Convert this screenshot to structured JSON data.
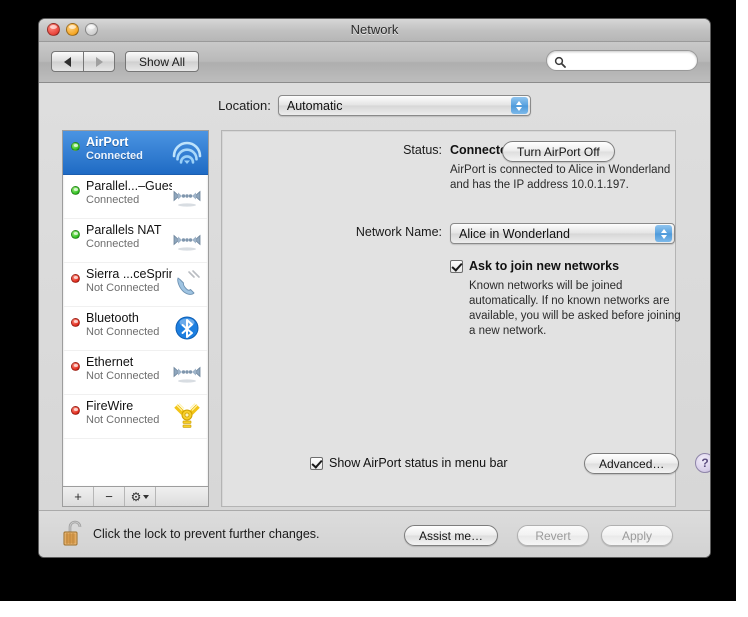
{
  "window": {
    "title": "Network",
    "traffic_lights": [
      "close",
      "minimize",
      "zoom"
    ]
  },
  "toolbar": {
    "back_label": "◀",
    "forward_label": "▶",
    "show_all_label": "Show All",
    "search_placeholder": "",
    "search_value": "",
    "search_icon": "search-icon"
  },
  "location": {
    "label": "Location:",
    "value": "Automatic"
  },
  "sidebar": {
    "services": [
      {
        "name": "AirPort",
        "state": "Connected",
        "status": "green",
        "icon": "airport-wifi-icon",
        "selected": true
      },
      {
        "name": "Parallel...–Guest",
        "state": "Connected",
        "status": "green",
        "icon": "ethernet-icon",
        "selected": false
      },
      {
        "name": "Parallels NAT",
        "state": "Connected",
        "status": "green",
        "icon": "ethernet-icon",
        "selected": false
      },
      {
        "name": "Sierra ...ceSprint",
        "state": "Not Connected",
        "status": "red",
        "icon": "modem-phone-icon",
        "selected": false
      },
      {
        "name": "Bluetooth",
        "state": "Not Connected",
        "status": "red",
        "icon": "bluetooth-icon",
        "selected": false
      },
      {
        "name": "Ethernet",
        "state": "Not Connected",
        "status": "red",
        "icon": "ethernet-icon",
        "selected": false
      },
      {
        "name": "FireWire",
        "state": "Not Connected",
        "status": "red",
        "icon": "firewire-icon",
        "selected": false
      }
    ],
    "toolbar": {
      "add_label": "+",
      "remove_label": "−",
      "action_label": "⚙"
    }
  },
  "detail": {
    "status_label": "Status:",
    "status_value": "Connected",
    "turn_off_label": "Turn AirPort Off",
    "status_description": "AirPort is connected to Alice in Wonderland and has the IP address 10.0.1.197.",
    "network_name_label": "Network Name:",
    "network_name_value": "Alice in Wonderland",
    "ask_to_join_label": "Ask to join new networks",
    "ask_to_join_checked": true,
    "ask_to_join_description": "Known networks will be joined automatically. If no known networks are available, you will be asked before joining a new network.",
    "show_status_label": "Show AirPort status in menu bar",
    "show_status_checked": true,
    "advanced_label": "Advanced…",
    "help_label": "?"
  },
  "footer": {
    "lock_icon": "unlocked-padlock-icon",
    "lock_text": "Click the lock to prevent further changes.",
    "assist_label": "Assist me…",
    "revert_label": "Revert",
    "apply_label": "Apply"
  },
  "colors": {
    "selection_blue": "#2f7cd4",
    "green_status": "#2fbd22",
    "red_status": "#de2a1c",
    "window_bg": "#d8d8d8",
    "pane_bg": "#e2e2e2"
  }
}
